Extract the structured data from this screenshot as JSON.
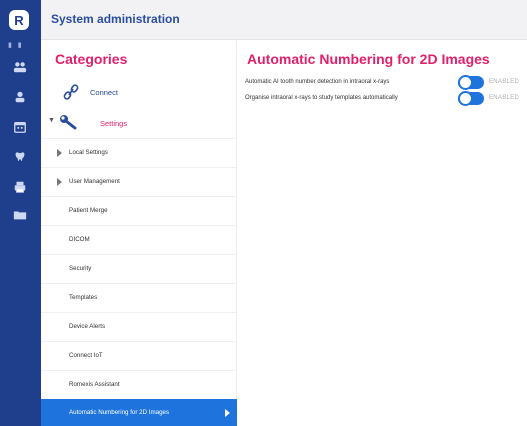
{
  "header": {
    "title": "System administration",
    "logo_letter": "R"
  },
  "rail": {
    "icons": [
      "users-icon",
      "user-icon",
      "calendar-icon",
      "tooth-icon",
      "printer-icon",
      "folder-icon"
    ]
  },
  "categories": {
    "heading": "Categories",
    "connect_label": "Connect",
    "settings_label": "Settings",
    "items": [
      {
        "label": "Local Settings",
        "expandable": true
      },
      {
        "label": "User Management",
        "expandable": true
      },
      {
        "label": "Patient Merge",
        "expandable": false
      },
      {
        "label": "DICOM",
        "expandable": false
      },
      {
        "label": "Security",
        "expandable": false
      },
      {
        "label": "Templates",
        "expandable": false
      },
      {
        "label": "Device Alerts",
        "expandable": false
      },
      {
        "label": "Connect IoT",
        "expandable": false
      },
      {
        "label": "Romexis Assistant",
        "expandable": false
      },
      {
        "label": "Automatic Numbering for 2D Images",
        "expandable": false,
        "active": true
      }
    ]
  },
  "main": {
    "title": "Automatic Numbering for 2D Images",
    "settings": [
      {
        "label": "Automatic AI tooth number detection in intraoral x-rays",
        "enabled": true,
        "status": "ENABLED"
      },
      {
        "label": "Organise intraoral x-rays to study templates automatically",
        "enabled": true,
        "status": "ENABLED"
      }
    ]
  },
  "colors": {
    "rail": "#1f3f8c",
    "accent_pink": "#e0206b",
    "accent_blue": "#1e74dc",
    "title_blue": "#2a4d9e"
  }
}
